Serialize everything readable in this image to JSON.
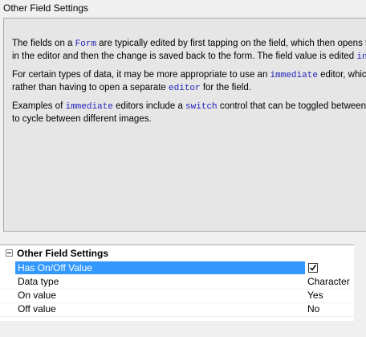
{
  "window": {
    "title": "Other Field Settings"
  },
  "help": {
    "p1": [
      {
        "t": "The fields on a ",
        "c": false
      },
      {
        "t": "Form",
        "c": true
      },
      {
        "t": " are typically edited by first tapping on the field, which then opens the",
        "c": false
      }
    ],
    "p1b": [
      {
        "t": "in the editor and then the change is saved back to the form. The field value is edited ",
        "c": false
      },
      {
        "t": "indir",
        "c": true
      }
    ],
    "p2": [
      {
        "t": "For certain types of data, it may be more appropriate to use an ",
        "c": false
      },
      {
        "t": "immediate",
        "c": true
      },
      {
        "t": " editor, which a",
        "c": false
      }
    ],
    "p2b": [
      {
        "t": "rather than having to open a separate ",
        "c": false
      },
      {
        "t": "editor",
        "c": true
      },
      {
        "t": " for the field.",
        "c": false
      }
    ],
    "p3": [
      {
        "t": "Examples of ",
        "c": false
      },
      {
        "t": "immediate",
        "c": true
      },
      {
        "t": " editors include a ",
        "c": false
      },
      {
        "t": "switch",
        "c": true
      },
      {
        "t": " control that can be toggled between an",
        "c": false
      }
    ],
    "p3b": [
      {
        "t": "to cycle between different images.",
        "c": false
      }
    ]
  },
  "grid": {
    "category": "Other Field Settings",
    "rows": [
      {
        "name": "Has On/Off Value",
        "value": "",
        "checked": true
      },
      {
        "name": "Data type",
        "value": "Character"
      },
      {
        "name": "On value",
        "value": "Yes"
      },
      {
        "name": "Off value",
        "value": "No"
      }
    ]
  }
}
